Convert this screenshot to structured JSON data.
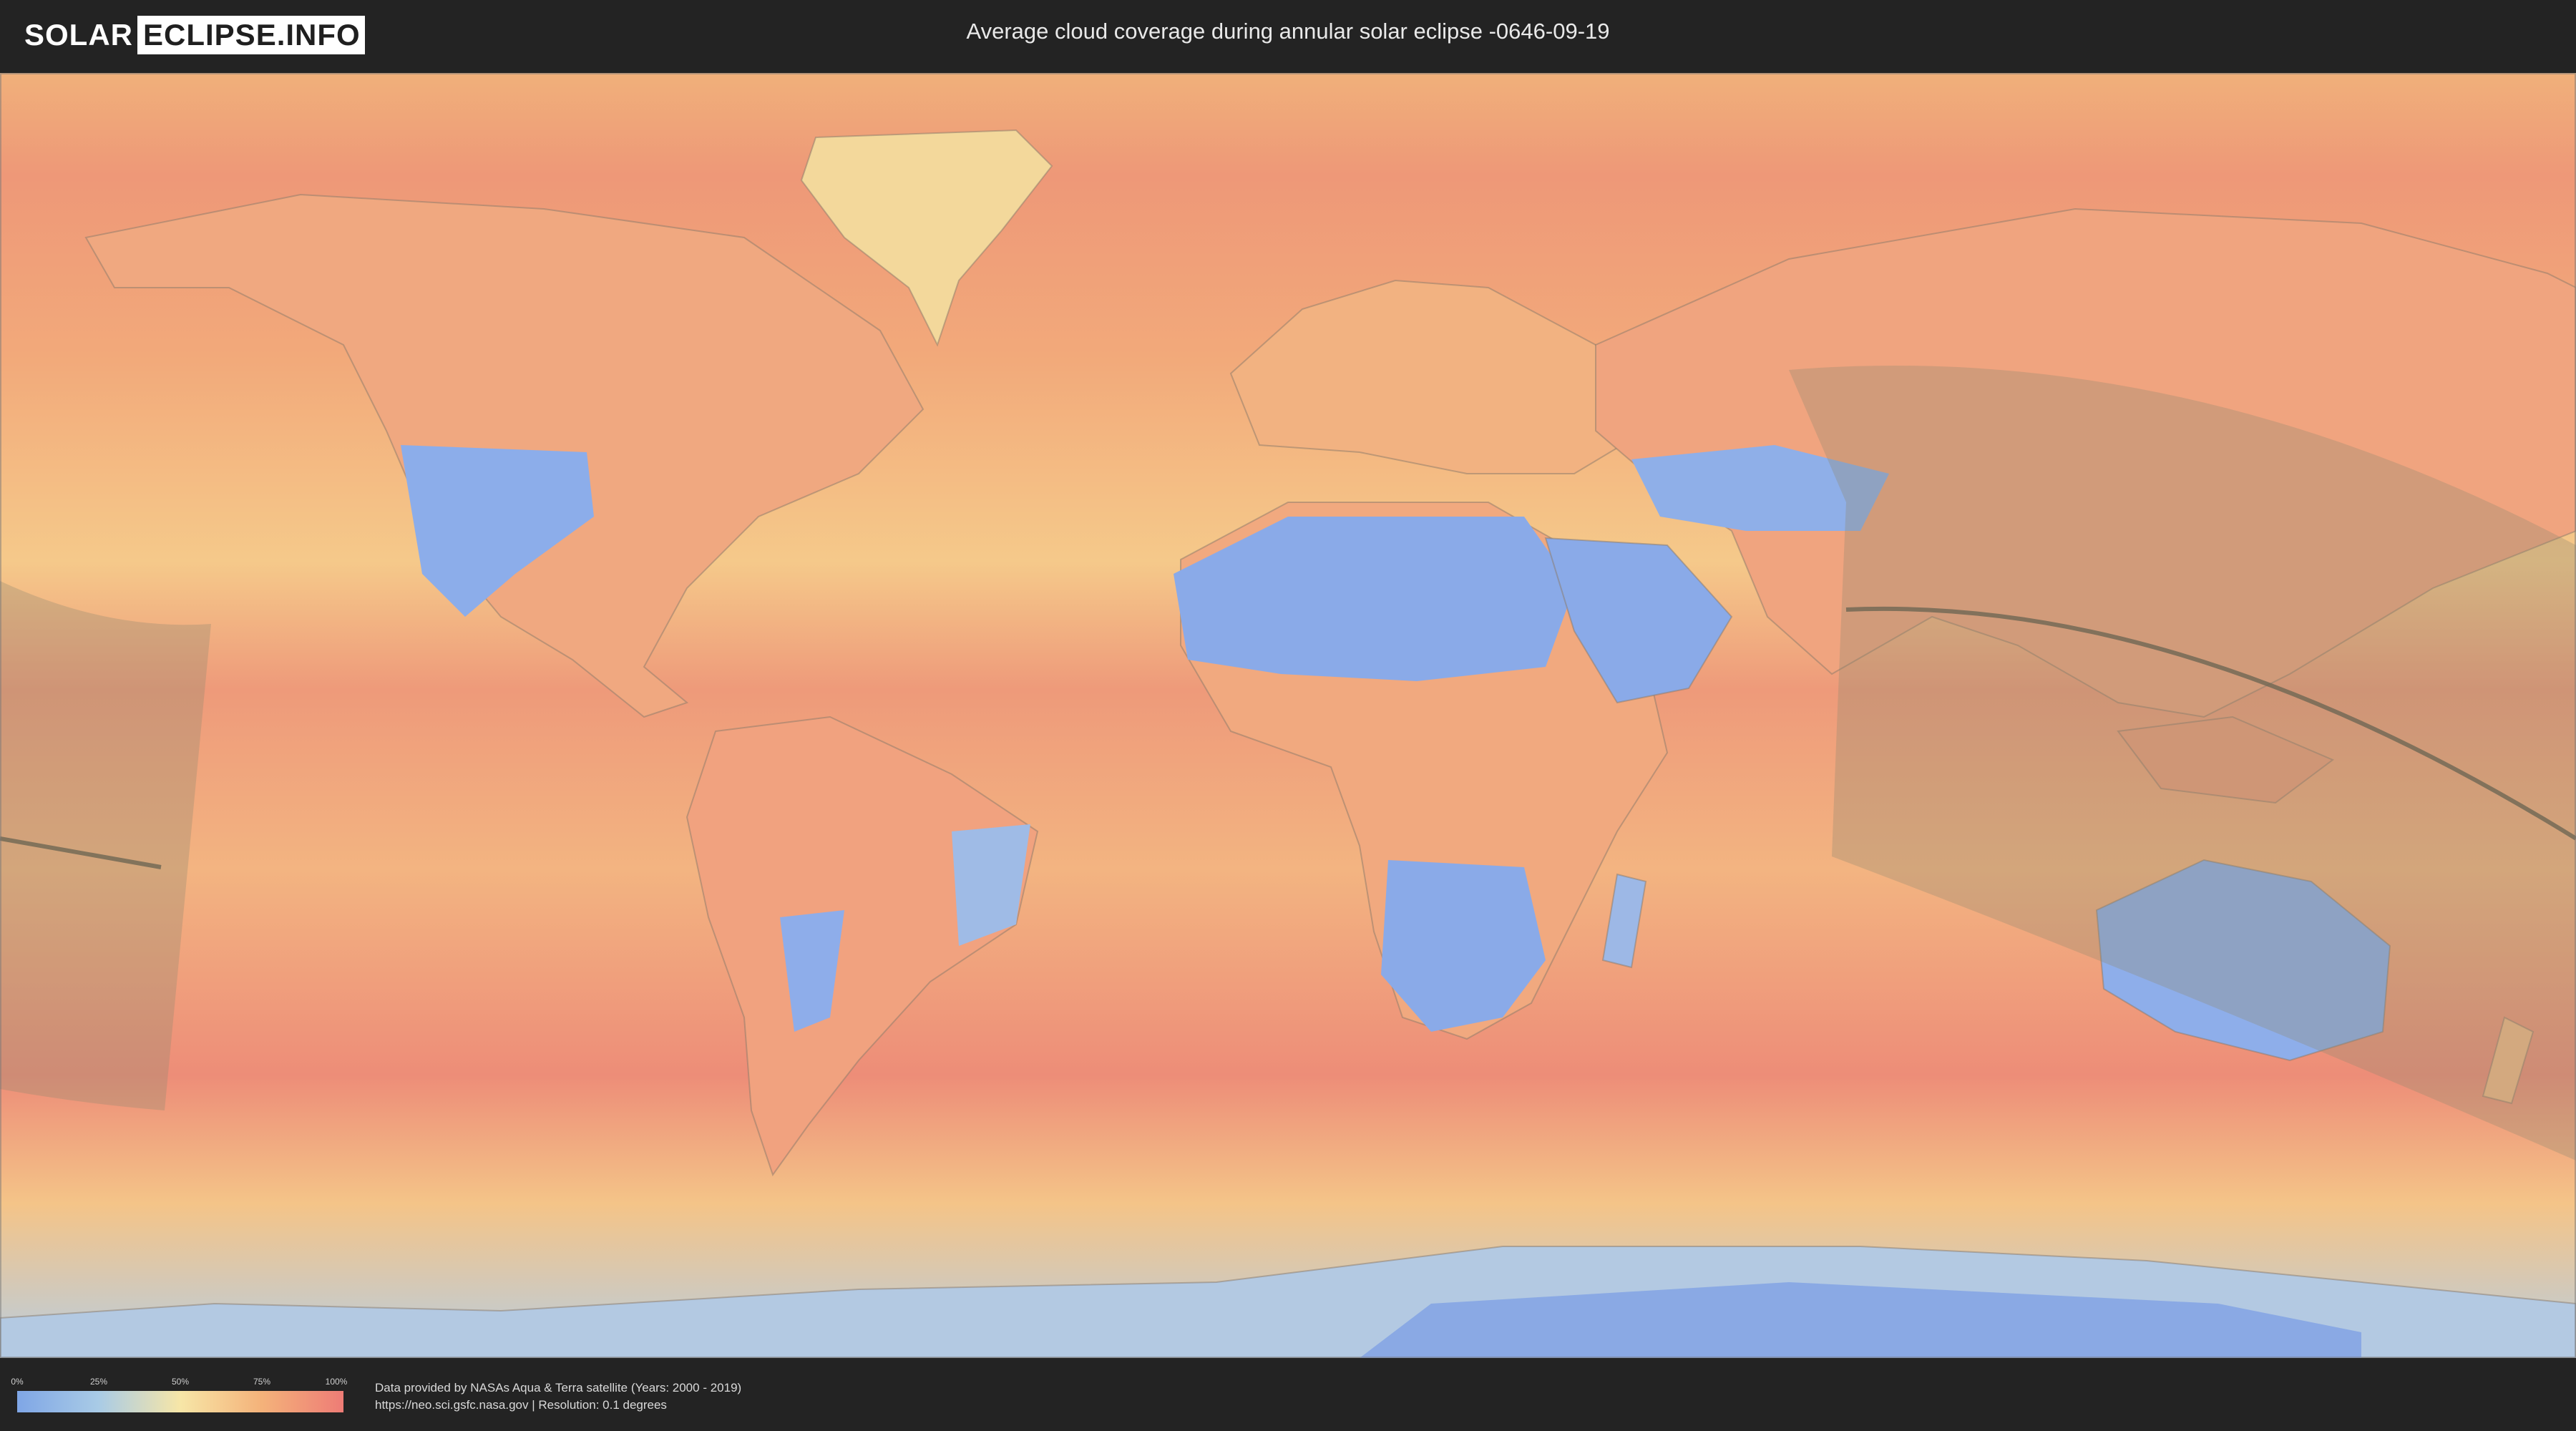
{
  "header": {
    "logo_left": "SOLAR",
    "logo_right": "ECLIPSE.INFO",
    "title": "Average cloud coverage during annular solar eclipse -0646-09-19"
  },
  "legend": {
    "ticks": [
      "0%",
      "25%",
      "50%",
      "75%",
      "100%"
    ],
    "colors": [
      "#7fa6e6",
      "#a9cbe6",
      "#f7e6a7",
      "#f4b27a",
      "#ee7c76"
    ]
  },
  "credits": {
    "line1": "Data provided by NASAs Aqua & Terra satellite (Years: 2000 - 2019)",
    "line2": "https://neo.sci.gsfc.nasa.gov | Resolution: 0.1 degrees"
  },
  "map": {
    "ocean_color": "#f3a679",
    "clear_sky_color": "#86a9e6",
    "eclipse_shadow_color": "#8f8a70"
  }
}
